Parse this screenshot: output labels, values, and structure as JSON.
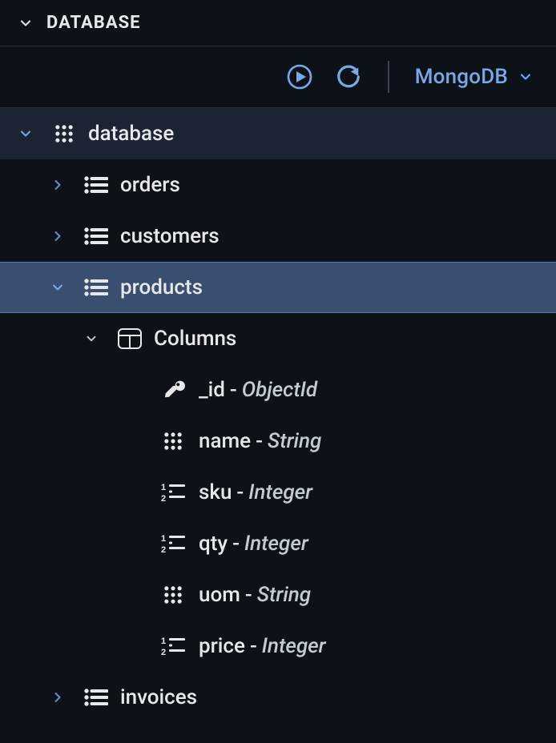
{
  "panel": {
    "title": "DATABASE"
  },
  "toolbar": {
    "engine_label": "MongoDB"
  },
  "tree": {
    "root": {
      "label": "database"
    },
    "collections": [
      {
        "label": "orders"
      },
      {
        "label": "customers"
      },
      {
        "label": "products",
        "selected": true
      },
      {
        "label": "invoices"
      }
    ],
    "columns_label": "Columns",
    "columns": [
      {
        "name": "_id",
        "type": "ObjectId",
        "icon": "key"
      },
      {
        "name": "name",
        "type": "String",
        "icon": "grid"
      },
      {
        "name": "sku",
        "type": "Integer",
        "icon": "numlist"
      },
      {
        "name": "qty",
        "type": "Integer",
        "icon": "numlist"
      },
      {
        "name": "uom",
        "type": "String",
        "icon": "grid"
      },
      {
        "name": "price",
        "type": "Integer",
        "icon": "numlist"
      }
    ]
  }
}
